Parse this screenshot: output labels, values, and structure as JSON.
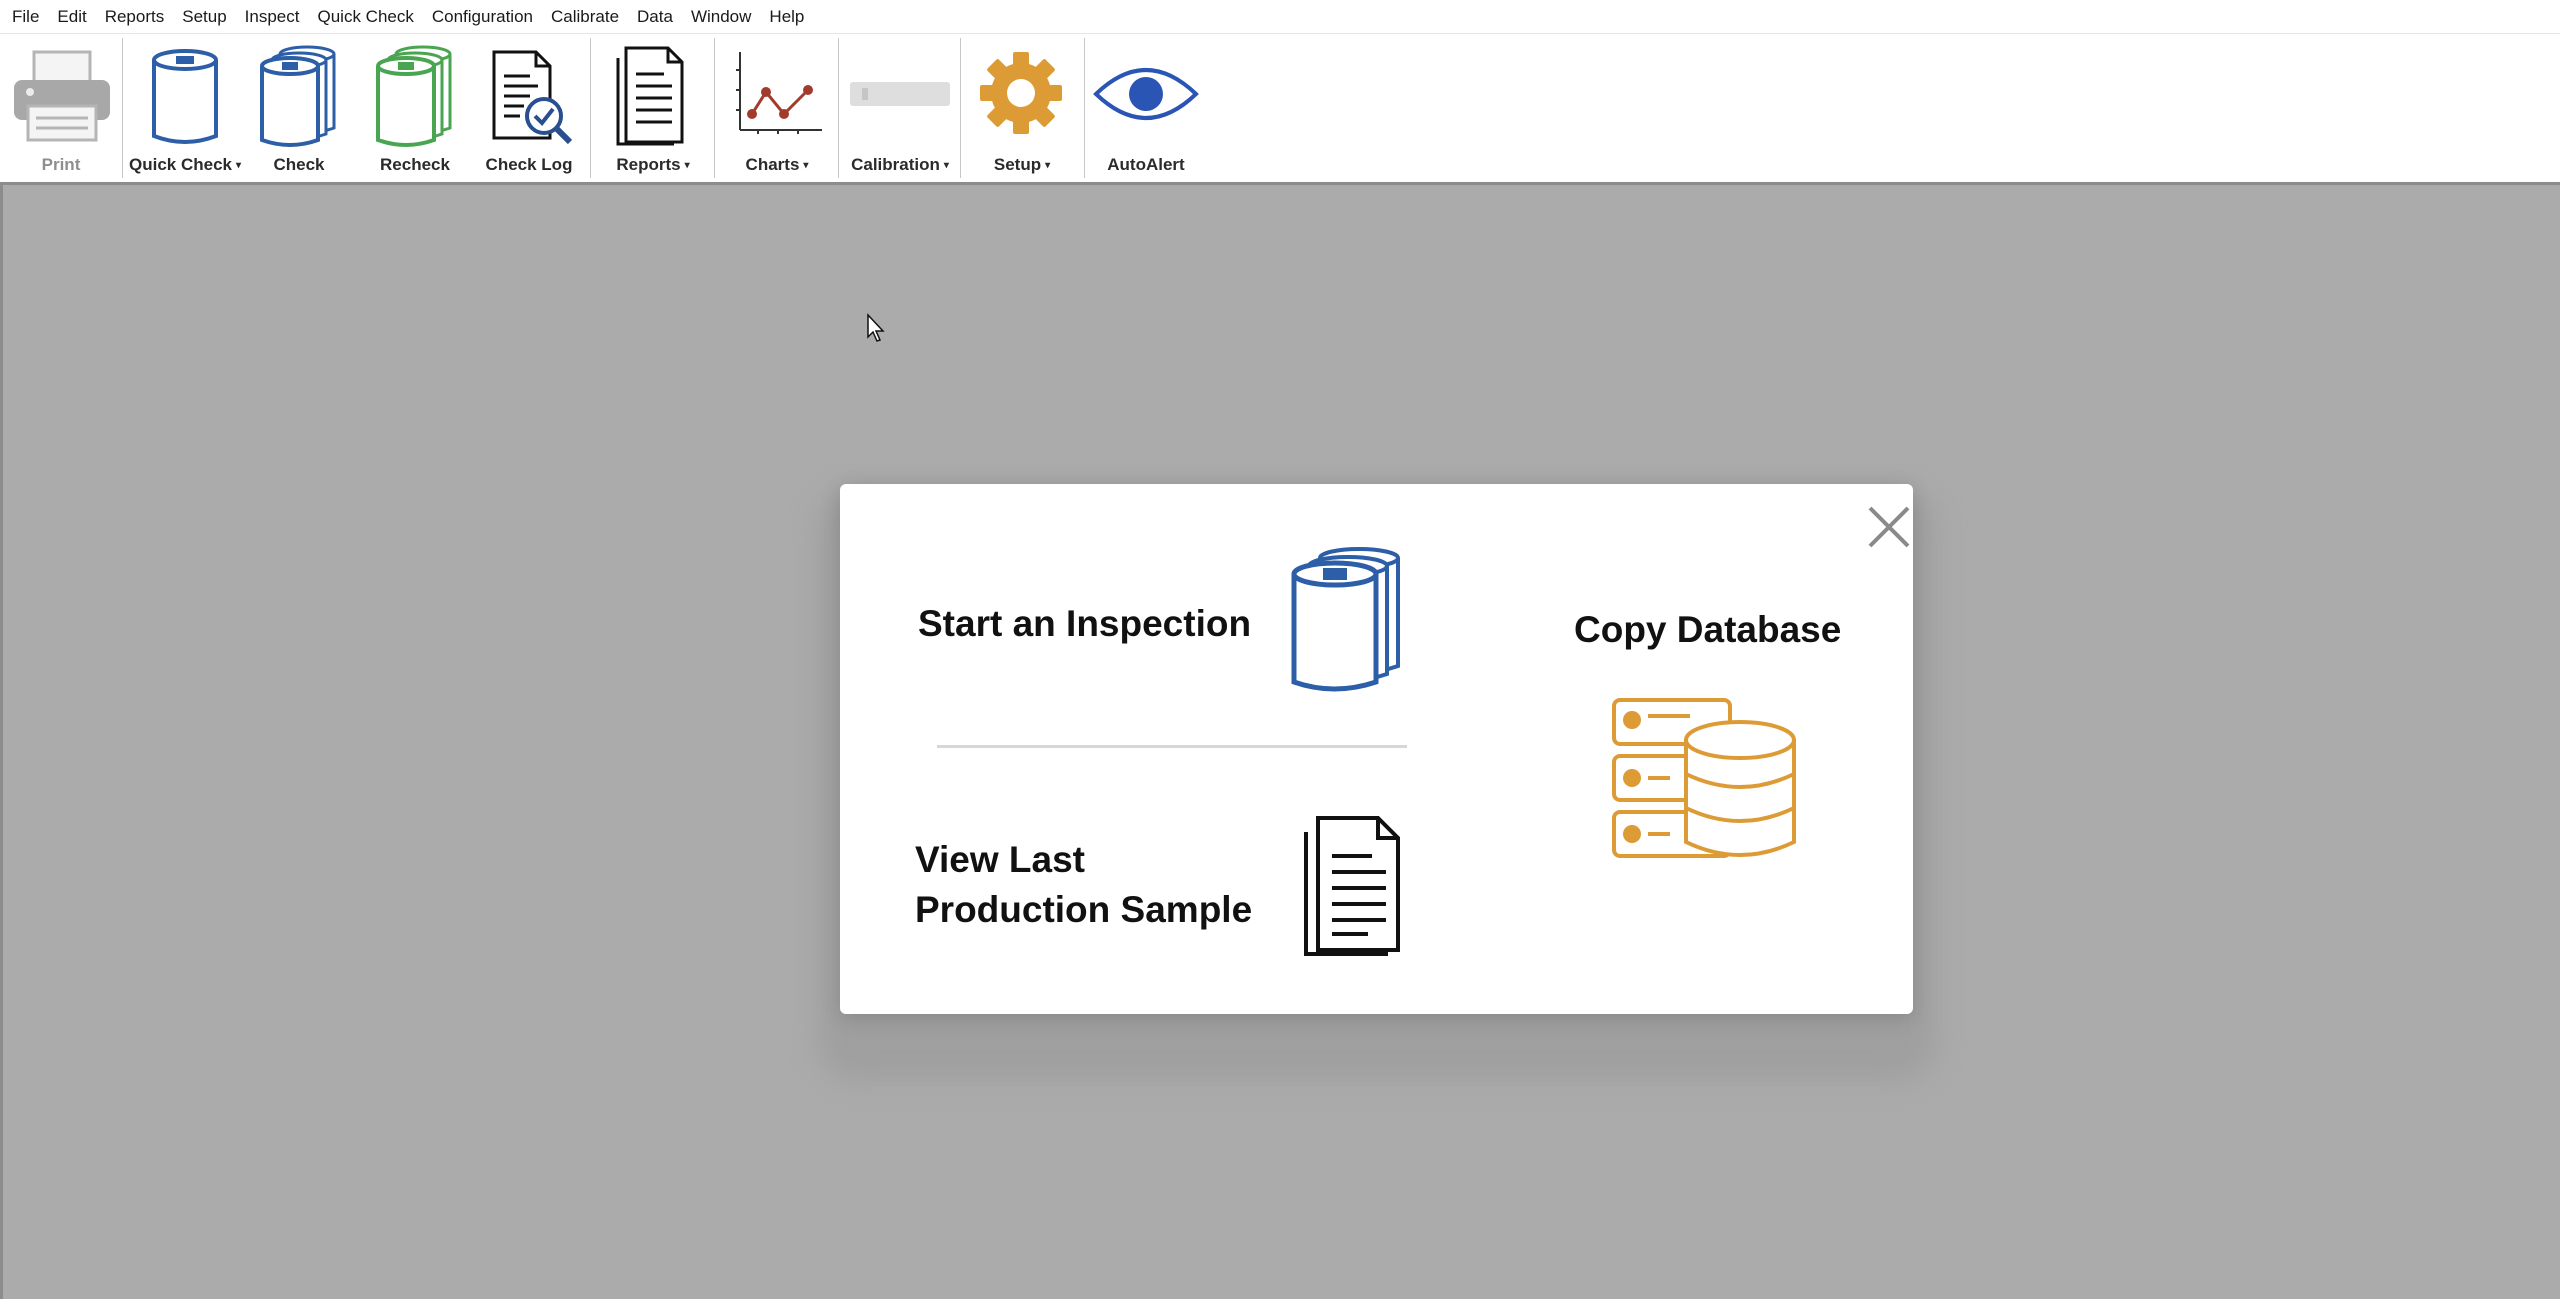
{
  "menu": [
    "File",
    "Edit",
    "Reports",
    "Setup",
    "Inspect",
    "Quick Check",
    "Configuration",
    "Calibrate",
    "Data",
    "Window",
    "Help"
  ],
  "toolbar": {
    "print": "Print",
    "quick_check": "Quick Check",
    "check": "Check",
    "recheck": "Recheck",
    "check_log": "Check Log",
    "reports": "Reports",
    "charts": "Charts",
    "calibration": "Calibration",
    "setup": "Setup",
    "autoalert": "AutoAlert",
    "dropdown_caret": "▾"
  },
  "dialog": {
    "start_inspection": "Start an Inspection",
    "view_last_line1": "View Last",
    "view_last_line2": "Production Sample",
    "copy_database": "Copy Database"
  },
  "icons": {
    "print": "printer-icon",
    "quick_check": "container-icon",
    "check": "stacked-containers-icon",
    "recheck": "stacked-containers-green-icon",
    "check_log": "document-magnifier-icon",
    "reports": "document-icon",
    "charts": "line-chart-icon",
    "calibration": "calibration-gauge-icon",
    "setup": "gear-icon",
    "autoalert": "eye-icon",
    "close": "close-icon",
    "database": "database-server-icon"
  },
  "colors": {
    "blue": "#2d5ea8",
    "green": "#4aa551",
    "orange": "#dd9b35",
    "chart_red": "#a23a2e",
    "eye_blue": "#2a55b5",
    "workspace": "#ababab"
  }
}
